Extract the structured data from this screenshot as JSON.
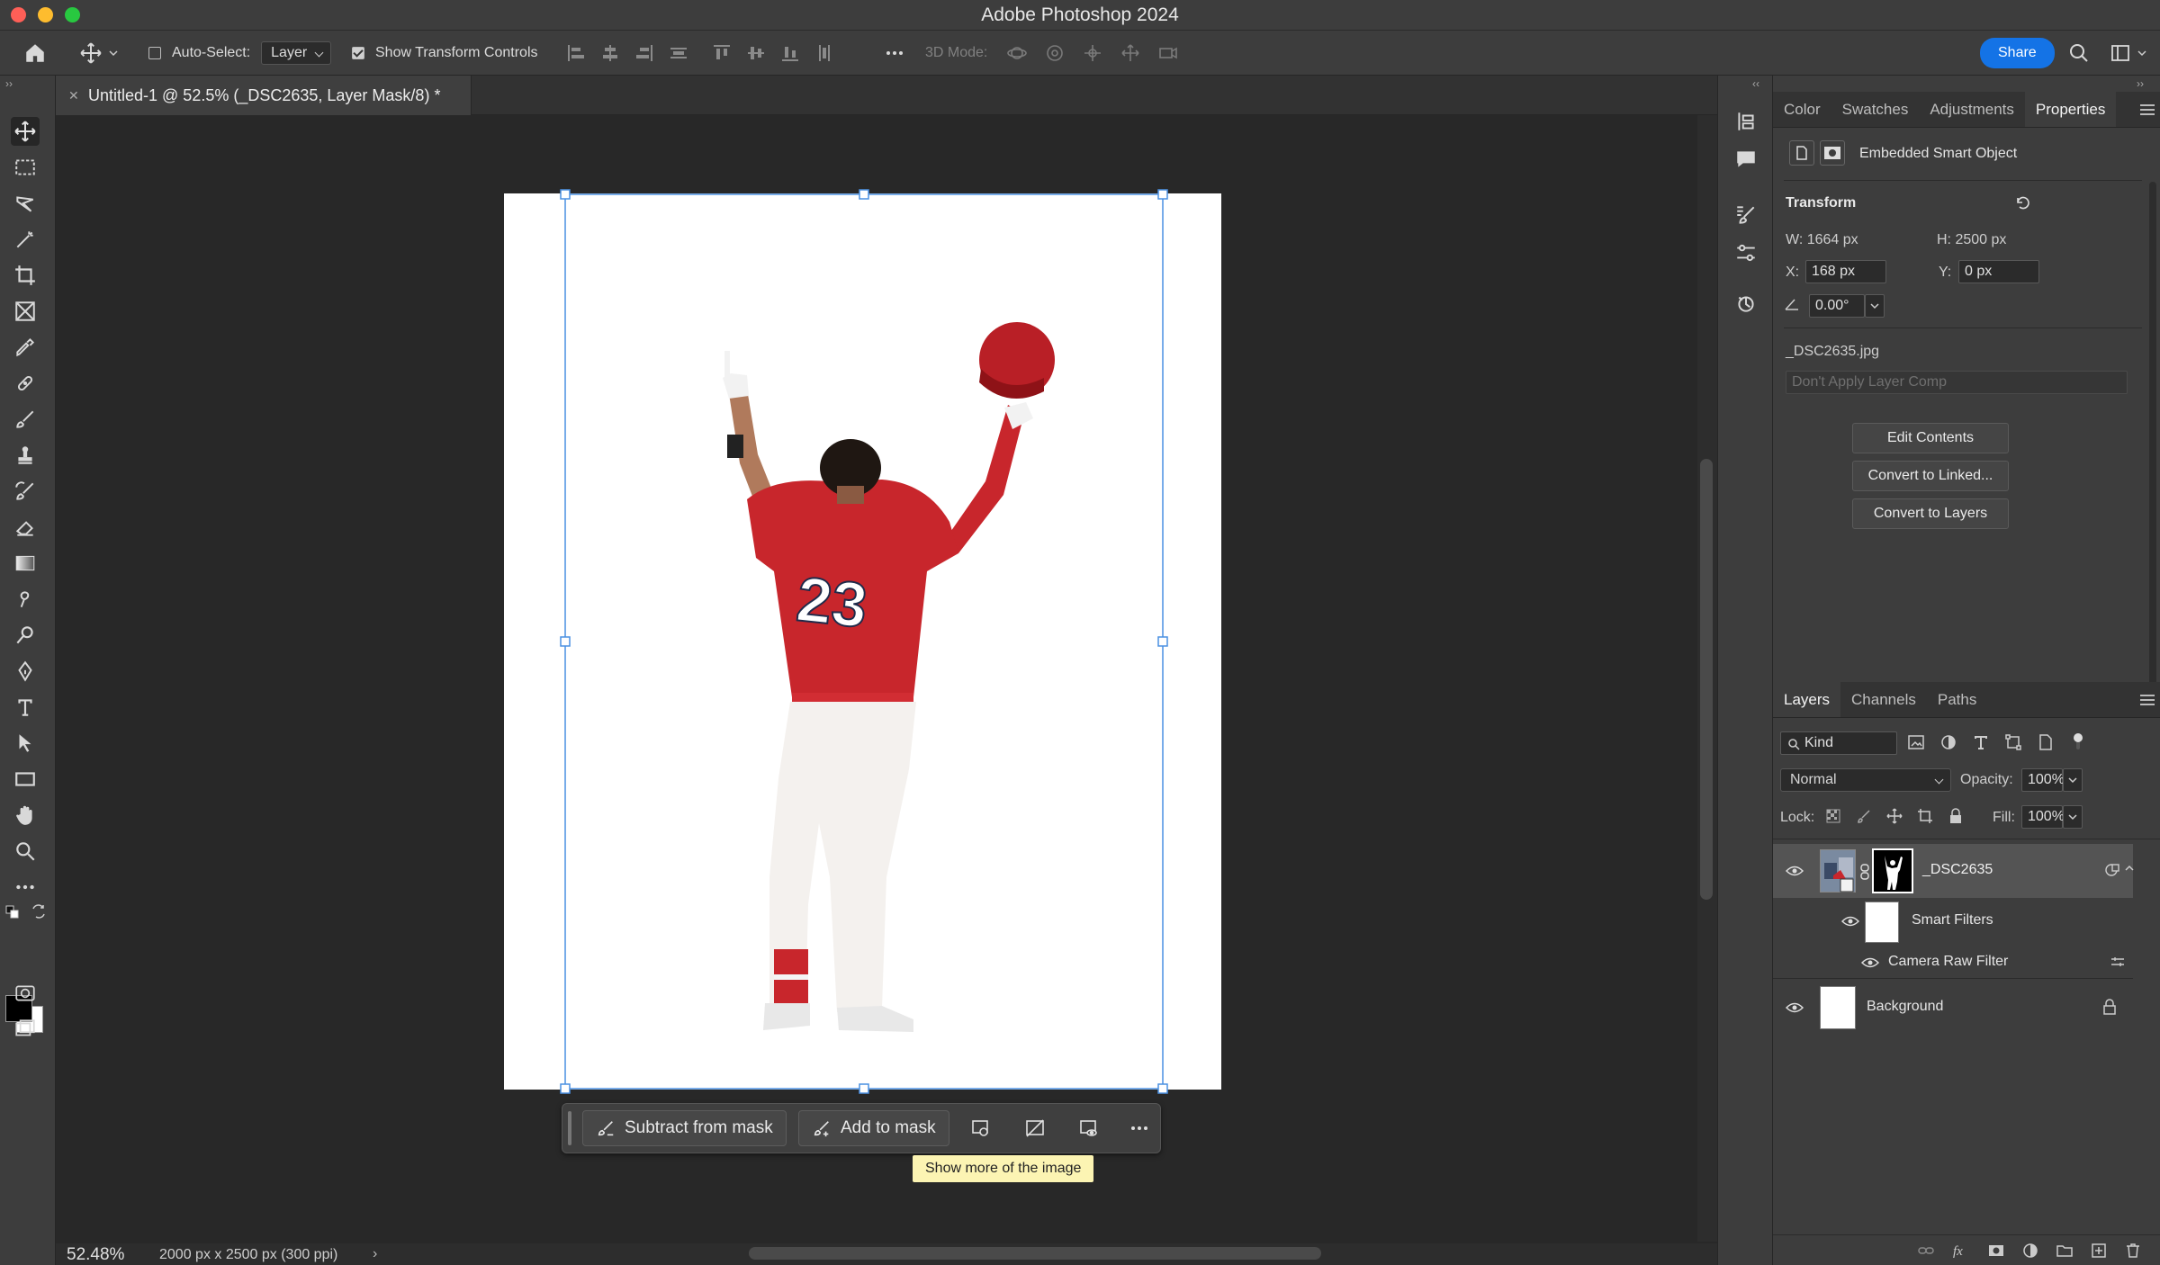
{
  "window": {
    "title": "Adobe Photoshop 2024"
  },
  "options_bar": {
    "auto_select_label": "Auto-Select:",
    "auto_select_value": "Layer",
    "show_transform_label": "Show Transform Controls",
    "mode_3d_label": "3D Mode:",
    "share_label": "Share"
  },
  "document": {
    "tab_title": "Untitled-1 @ 52.5% (_DSC2635, Layer Mask/8) *",
    "zoom": "52.48%",
    "doc_info": "2000 px x 2500 px (300 ppi)"
  },
  "context_bar": {
    "subtract_label": "Subtract from mask",
    "add_label": "Add to mask",
    "tooltip": "Show more of the image"
  },
  "properties": {
    "tabs": [
      "Color",
      "Swatches",
      "Adjustments",
      "Properties"
    ],
    "active_tab": "Properties",
    "object_type": "Embedded Smart Object",
    "transform_title": "Transform",
    "w": "W:  1664 px",
    "h": "H:  2500 px",
    "x_label": "X:",
    "x_value": "168 px",
    "y_label": "Y:",
    "y_value": "0 px",
    "angle_value": "0.00°",
    "file_name": "_DSC2635.jpg",
    "layer_comp_placeholder": "Don't Apply Layer Comp",
    "buttons": [
      "Edit Contents",
      "Convert to Linked...",
      "Convert to Layers"
    ]
  },
  "layers_panel": {
    "tabs": [
      "Layers",
      "Channels",
      "Paths"
    ],
    "filter_kind": "Kind",
    "blend_mode": "Normal",
    "opacity_label": "Opacity:",
    "opacity_value": "100%",
    "lock_label": "Lock:",
    "fill_label": "Fill:",
    "fill_value": "100%",
    "layers": [
      {
        "name": "_DSC2635"
      },
      {
        "name": "Smart Filters"
      },
      {
        "name": "Camera Raw Filter"
      },
      {
        "name": "Background"
      }
    ]
  },
  "colors": {
    "accent": "#1473e6",
    "selection": "#4a90e2",
    "jersey": "#c8262c"
  }
}
